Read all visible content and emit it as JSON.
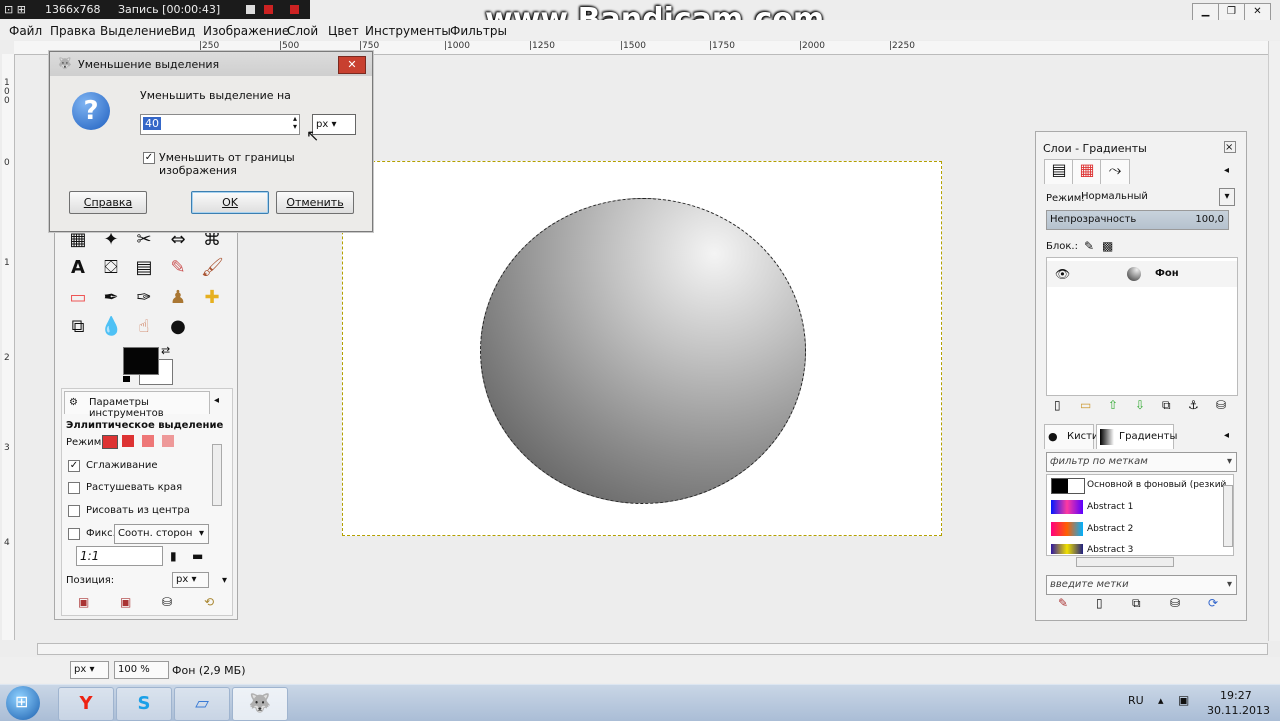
{
  "recorder": {
    "resolution": "1366x768",
    "status": "Запись [00:00:43]",
    "watermark": "www.Bandicam.com"
  },
  "menubar": {
    "items": [
      "Файл",
      "Правка",
      "Выделение",
      "Вид",
      "Изображение",
      "Слой",
      "Цвет",
      "Инструменты",
      "Фильтры"
    ]
  },
  "rulers": {
    "h": [
      "|250",
      "|500",
      "|750",
      "|1000",
      "|1250",
      "|1500",
      "|1750",
      "|2000",
      "|2250"
    ],
    "v": [
      "100",
      "0",
      "1",
      "2",
      "3",
      "4"
    ]
  },
  "dialog": {
    "title": "Уменьшение выделения",
    "close_label": "✕",
    "prompt": "Уменьшить выделение на",
    "value": "40",
    "unit": "px",
    "checkbox_label": "Уменьшить от границы изображения",
    "checkbox_mark": "✓",
    "help_label": "Справка",
    "ok_label": "OK",
    "cancel_label": "Отменить"
  },
  "toolbox": {
    "options_tab": "Параметры инструментов",
    "tool_name": "Эллиптическое выделение",
    "mode_label": "Режим:",
    "antialias_label": "Сглаживание",
    "antialias_mark": "✓",
    "feather_label": "Растушевать края",
    "center_label": "Рисовать из центра",
    "fixed_label": "Фикс.:",
    "fixed_value": "Соотн. сторон",
    "ratio_value": "1:1",
    "position_label": "Позиция:",
    "position_unit": "px"
  },
  "layers": {
    "title": "Слои - Градиенты",
    "mode_label": "Режим:",
    "mode_value": "Нормальный",
    "opacity_label": "Непрозрачность",
    "opacity_value": "100,0",
    "lock_label": "Блок.:",
    "layer_name": "Фон"
  },
  "gradients": {
    "tab_brushes": "Кисти",
    "tab_gradients": "Градиенты",
    "filter_placeholder": "фильтр по меткам",
    "items": [
      "Основной в фоновый (резкий",
      "Abstract 1",
      "Abstract 2",
      "Abstract 3"
    ],
    "tags_placeholder": "введите метки"
  },
  "status": {
    "unit": "px",
    "zoom": "100 %",
    "info": "Фон (2,9 МБ)"
  },
  "taskbar": {
    "lang": "RU",
    "time": "19:27",
    "date": "30.11.2013"
  },
  "colors": {
    "fg": "#050505",
    "bg": "#ffffff",
    "selection": "#3567c8",
    "accent_close": "#c8402f"
  }
}
